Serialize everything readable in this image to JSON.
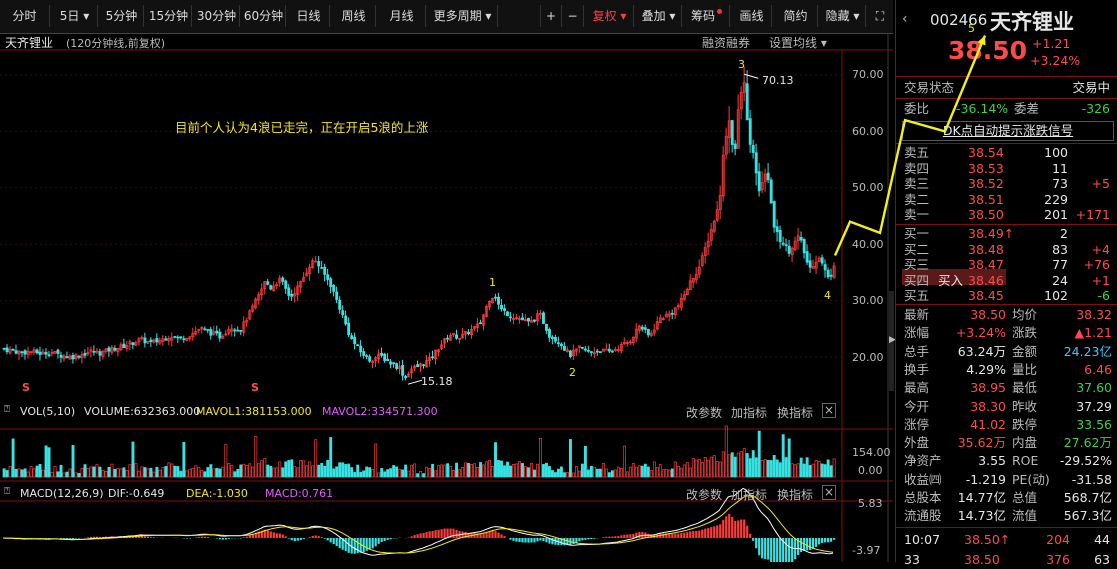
{
  "toolbar": {
    "periods": [
      "分时",
      "5日",
      "5分钟",
      "15分钟",
      "30分钟",
      "60分钟",
      "日线",
      "周线",
      "月线",
      "更多周期"
    ],
    "controls": [
      "+",
      "−",
      "复权",
      "叠加",
      "筹码",
      "画线",
      "简约",
      "隐藏",
      "⛶"
    ]
  },
  "chart": {
    "stock_name": "天齐锂业",
    "period_note": "(120分钟线,前复权)",
    "rzrq": "融资融券",
    "ma_setting": "设置均线",
    "annotation": "目前个人认为4浪已走完，正在开启5浪的上涨",
    "high_label": "70.13",
    "low_label": "15.18",
    "wave_labels": [
      "1",
      "2",
      "3",
      "4",
      "5"
    ],
    "s_marker": "S",
    "y_axis": [
      "70.00",
      "60.00",
      "50.00",
      "40.00",
      "30.00",
      "20.00"
    ],
    "vol": {
      "title": "VOL(5,10)",
      "volume": "VOLUME:632363.000",
      "mavol1": "MAVOL1:381153.000",
      "mavol2": "MAVOL2:334571.300",
      "axis_top": "154.00",
      "axis_bottom": "0.00",
      "btns": [
        "改参数",
        "加指标",
        "换指标"
      ]
    },
    "macd": {
      "title": "MACD(12,26,9)",
      "dif": "DIF:-0.649",
      "dea": "DEA:-1.030",
      "macd": "MACD:0.761",
      "axis_top": "5.83",
      "axis_bottom": "-3.97",
      "btns": [
        "改参数",
        "加指标",
        "换指标"
      ]
    },
    "close_btn": "×"
  },
  "chart_data": {
    "type": "candlestick",
    "title": "天齐锂业",
    "ylabel": "",
    "ylim": [
      13,
      74
    ],
    "x": "120-minute bars (index)",
    "close_path": [
      [
        0,
        21.5
      ],
      [
        10,
        21.2
      ],
      [
        20,
        20.8
      ],
      [
        30,
        21.0
      ],
      [
        40,
        20.6
      ],
      [
        50,
        20.9
      ],
      [
        60,
        20.3
      ],
      [
        70,
        20.0
      ],
      [
        80,
        20.4
      ],
      [
        90,
        21.0
      ],
      [
        100,
        20.7
      ],
      [
        110,
        21.4
      ],
      [
        120,
        21.8
      ],
      [
        130,
        22.4
      ],
      [
        140,
        23.1
      ],
      [
        150,
        22.5
      ],
      [
        160,
        23.0
      ],
      [
        170,
        23.8
      ],
      [
        180,
        23.2
      ],
      [
        190,
        24.0
      ],
      [
        200,
        25.1
      ],
      [
        210,
        24.3
      ],
      [
        220,
        23.6
      ],
      [
        230,
        25.4
      ],
      [
        240,
        24.8
      ],
      [
        250,
        28.0
      ],
      [
        260,
        31.5
      ],
      [
        265,
        33.5
      ],
      [
        270,
        32.2
      ],
      [
        280,
        33.8
      ],
      [
        290,
        30.5
      ],
      [
        300,
        33.0
      ],
      [
        310,
        36.5
      ],
      [
        315,
        37.2
      ],
      [
        320,
        35.8
      ],
      [
        330,
        33.0
      ],
      [
        340,
        28.5
      ],
      [
        350,
        23.5
      ],
      [
        360,
        21.0
      ],
      [
        370,
        19.4
      ],
      [
        380,
        20.3
      ],
      [
        390,
        19.0
      ],
      [
        400,
        18.0
      ],
      [
        405,
        16.2
      ],
      [
        410,
        17.8
      ],
      [
        420,
        18.5
      ],
      [
        430,
        19.6
      ],
      [
        440,
        22.0
      ],
      [
        450,
        24.0
      ],
      [
        460,
        23.5
      ],
      [
        470,
        24.6
      ],
      [
        480,
        25.8
      ],
      [
        490,
        30.5
      ],
      [
        495,
        31.0
      ],
      [
        500,
        28.6
      ],
      [
        510,
        27.4
      ],
      [
        520,
        26.8
      ],
      [
        530,
        26.0
      ],
      [
        540,
        27.6
      ],
      [
        550,
        23.8
      ],
      [
        560,
        22.6
      ],
      [
        570,
        20.3
      ],
      [
        580,
        21.6
      ],
      [
        590,
        20.8
      ],
      [
        600,
        21.2
      ],
      [
        610,
        20.9
      ],
      [
        620,
        21.8
      ],
      [
        630,
        22.8
      ],
      [
        640,
        25.6
      ],
      [
        650,
        23.6
      ],
      [
        660,
        26.8
      ],
      [
        670,
        27.6
      ],
      [
        680,
        29.3
      ],
      [
        690,
        33.0
      ],
      [
        700,
        36.0
      ],
      [
        710,
        41.5
      ],
      [
        720,
        47.2
      ],
      [
        725,
        58.0
      ],
      [
        730,
        62.0
      ],
      [
        735,
        55.0
      ],
      [
        740,
        66.0
      ],
      [
        745,
        68.5
      ],
      [
        750,
        58.0
      ],
      [
        755,
        55.2
      ],
      [
        760,
        49.0
      ],
      [
        765,
        53.0
      ],
      [
        770,
        50.5
      ],
      [
        775,
        43.0
      ],
      [
        780,
        41.0
      ],
      [
        790,
        38.8
      ],
      [
        800,
        41.5
      ],
      [
        810,
        35.6
      ],
      [
        820,
        37.8
      ],
      [
        830,
        33.6
      ],
      [
        835,
        36.5
      ]
    ],
    "high_point": {
      "x": 742,
      "y": 70.13
    },
    "low_point": {
      "x": 405,
      "y": 15.18
    },
    "projection": [
      [
        835,
        38.0
      ],
      [
        850,
        44.0
      ],
      [
        880,
        42.0
      ],
      [
        905,
        62.0
      ],
      [
        945,
        60.0
      ],
      [
        985,
        77.0
      ]
    ],
    "volume_max": 154.0,
    "macd_range": [
      -3.97,
      5.83
    ]
  },
  "side": {
    "code": "002466",
    "name": "天齐锂业",
    "price": "38.50",
    "change": "+1.21",
    "change_pct": "+3.24%",
    "status_label": "交易状态",
    "status_value": "交易中",
    "wb_label": "委比",
    "wb_value": "-36.14%",
    "wc_label": "委差",
    "wc_value": "-326",
    "dk_title": "DK点自动提示涨跌信号",
    "asks": [
      {
        "l": "卖五",
        "p": "38.54",
        "v": "100",
        "d": ""
      },
      {
        "l": "卖四",
        "p": "38.53",
        "v": "11",
        "d": ""
      },
      {
        "l": "卖三",
        "p": "38.52",
        "v": "73",
        "d": "+5"
      },
      {
        "l": "卖二",
        "p": "38.51",
        "v": "229",
        "d": ""
      },
      {
        "l": "卖一",
        "p": "38.50",
        "v": "201",
        "d": "+171"
      }
    ],
    "bids": [
      {
        "l": "买一",
        "p": "38.49↑",
        "v": "2",
        "d": ""
      },
      {
        "l": "买二",
        "p": "38.48",
        "v": "83",
        "d": "+4"
      },
      {
        "l": "买三",
        "p": "38.47",
        "v": "77",
        "d": "+76"
      },
      {
        "l": "买四",
        "p": "38.46",
        "v": "24",
        "d": "+1"
      },
      {
        "l": "买五",
        "p": "38.45",
        "v": "102",
        "d": "-6"
      }
    ],
    "buy_btn": "买入",
    "stats": [
      [
        "最新",
        "38.50",
        "均价",
        "38.32"
      ],
      [
        "涨幅",
        "+3.24%",
        "涨跌",
        "▲1.21"
      ],
      [
        "总手",
        "63.24万",
        "金额",
        "24.23亿"
      ],
      [
        "换手",
        "4.29%",
        "量比",
        "6.46"
      ],
      [
        "最高",
        "38.95",
        "最低",
        "37.60"
      ],
      [
        "今开",
        "38.30",
        "昨收",
        "37.29"
      ],
      [
        "涨停",
        "41.02",
        "跌停",
        "33.56"
      ],
      [
        "外盘",
        "35.62万",
        "内盘",
        "27.62万"
      ],
      [
        "净资产",
        "3.55",
        "ROE",
        "-29.52%"
      ],
      [
        "收益㈣",
        "-1.219",
        "PE(动)",
        "-31.58"
      ],
      [
        "总股本",
        "14.77亿",
        "总值",
        "568.7亿"
      ],
      [
        "流通股",
        "14.73亿",
        "流值",
        "567.3亿"
      ]
    ],
    "ticks": [
      [
        "10:07",
        "38.50↑",
        "204",
        "44"
      ],
      [
        "33",
        "38.50",
        "376",
        "63"
      ]
    ]
  },
  "colors": {
    "up": "#ff3b3b",
    "down": "#37e3e3",
    "ma1": "#f3e81b",
    "ma2": "#e65bff",
    "grid": "#7a1010"
  }
}
